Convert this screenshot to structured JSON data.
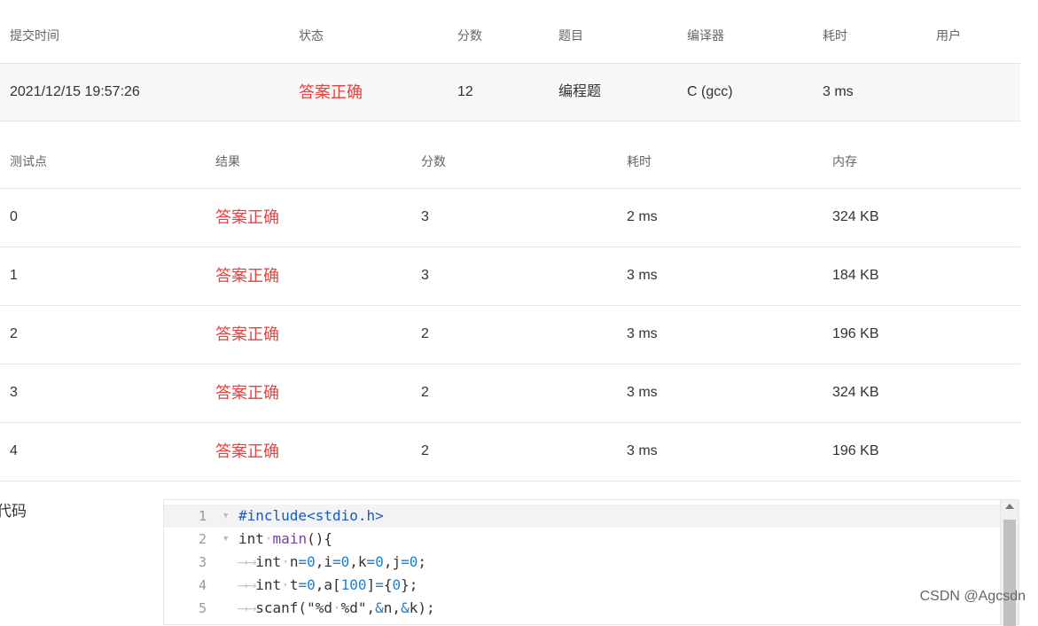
{
  "summary": {
    "headers": {
      "submit_time": "提交时间",
      "status": "状态",
      "score": "分数",
      "problem": "题目",
      "compiler": "编译器",
      "time": "耗时",
      "user": "用户"
    },
    "row": {
      "submit_time": "2021/12/15 19:57:26",
      "status": "答案正确",
      "score": "12",
      "problem": "编程题",
      "compiler": "C (gcc)",
      "time": "3 ms",
      "user": ""
    }
  },
  "cases": {
    "headers": {
      "case": "测试点",
      "result": "结果",
      "score": "分数",
      "time": "耗时",
      "memory": "内存"
    },
    "rows": [
      {
        "case": "0",
        "result": "答案正确",
        "score": "3",
        "time": "2 ms",
        "memory": "324 KB"
      },
      {
        "case": "1",
        "result": "答案正确",
        "score": "3",
        "time": "3 ms",
        "memory": "184 KB"
      },
      {
        "case": "2",
        "result": "答案正确",
        "score": "2",
        "time": "3 ms",
        "memory": "196 KB"
      },
      {
        "case": "3",
        "result": "答案正确",
        "score": "2",
        "time": "3 ms",
        "memory": "324 KB"
      },
      {
        "case": "4",
        "result": "答案正确",
        "score": "2",
        "time": "3 ms",
        "memory": "196 KB"
      }
    ]
  },
  "code": {
    "label": "代码",
    "line_numbers": [
      "1",
      "2",
      "3",
      "4",
      "5"
    ],
    "fold_icon": "triangle-down-icon",
    "colors": {
      "accent_red": "#e8403f",
      "preprocessor": "#1a5ab8",
      "function": "#7a3e9d",
      "number": "#1c7fd6"
    }
  },
  "watermark": "CSDN @Agcsdn"
}
